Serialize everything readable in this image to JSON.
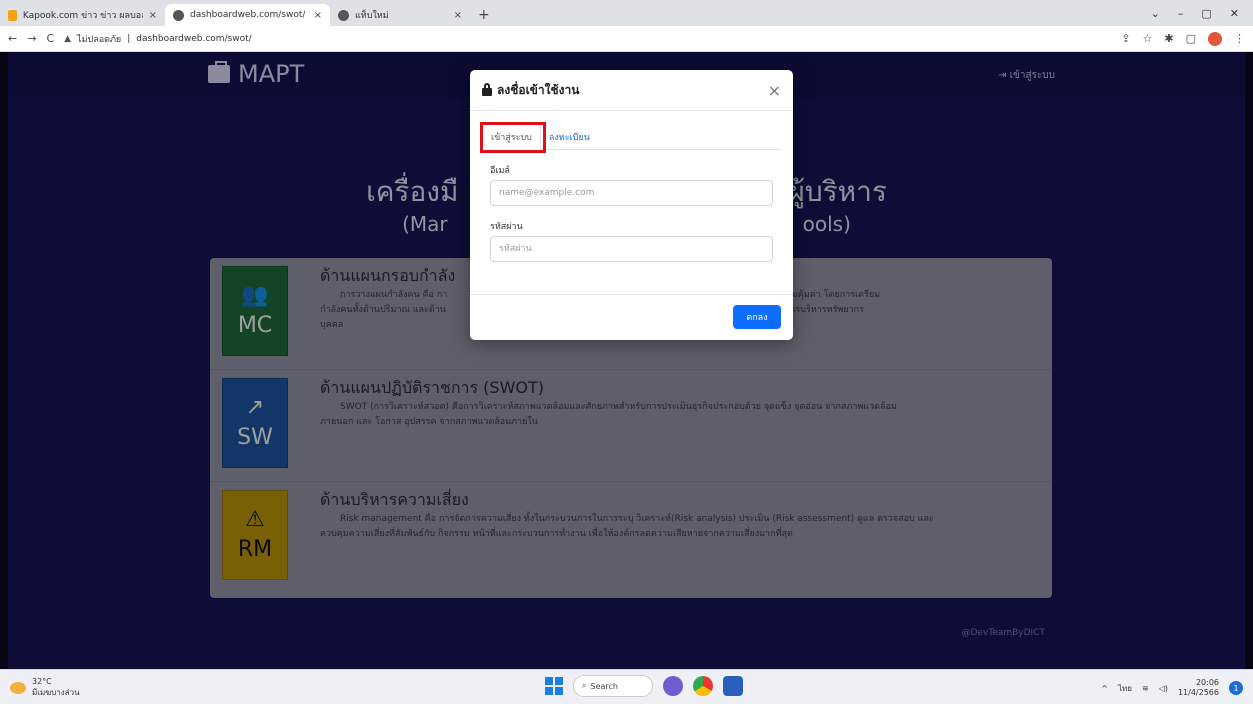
{
  "browser": {
    "tabs": [
      {
        "title": "Kapook.com ข่าว ข่าว ผลบอล ดูดวง",
        "close": "×"
      },
      {
        "title": "dashboardweb.com/swot/",
        "close": "×"
      },
      {
        "title": "แท็บใหม่",
        "close": "×"
      }
    ],
    "new_tab": "+",
    "security_label": "ไม่ปลอดภัย",
    "url": "dashboardweb.com/swot/",
    "window_controls": [
      "⌄",
      "–",
      "▢",
      "✕"
    ]
  },
  "navbar": {
    "brand": "MAPT",
    "login": "⇥ เข้าสู่ระบบ"
  },
  "hero": {
    "title_left": "เครื่องมื",
    "title_right": "ผู้บริหาร",
    "sub_left": "(Mar",
    "sub_right": "ools)"
  },
  "sections": [
    {
      "tile_label": "MC",
      "tile_icon": "users-icon",
      "title": "ด้านแผนกรอบกำลัง",
      "body_left": "การวางแผนกำลังคน คือ กา",
      "body_right": "เกิดประสิทธิภาพ และมีความคุ้มค่า โดยการเตรียม",
      "body_line2_left": "กำลังคนทั้งด้านปริมาณ และด้าน",
      "body_line2_right": "นี้เป็นเครื่องมือช่วยตัดสินใจ ในการบริหารทรัพยากร",
      "body_line3": "บุคคล"
    },
    {
      "tile_label": "SW",
      "tile_icon": "chart-line-icon",
      "title": "ด้านแผนปฏิบัติราชการ (SWOT)",
      "body": "SWOT (การวิเคราะห์สวอต) คือการวิเคราะห์สภาพแวดล้อมและศักยภาพสำหรับการประเมินธุรกิจประกอบด้วย จุดแข็ง จุดอ่อน จากสภาพแวดล้อม",
      "body_line2": "ภายนอก และ โอกาส อุปสรรค จากสภาพแวดล้อมภายใน"
    },
    {
      "tile_label": "RM",
      "tile_icon": "warning-icon",
      "title": "ด้านบริหารความเสี่ยง",
      "body": "Risk management คือ การจัดการความเสี่ยง ทั้งในกระบวนการในการระบุ วิเคราะห์(Risk analysis) ประเมิน (Risk assessment) ดูแล ตรวจสอบ และ",
      "body_line2": "ควบคุมความเสี่ยงที่สัมพันธ์กับ กิจกรรม หน้าที่และกระบวนการทำงาน เพื่อให้องค์กรลดความเสียหายจากความเสี่ยงมากที่สุด"
    }
  ],
  "footer": {
    "credit": "@DevTeamByDICT"
  },
  "modal": {
    "title": "ลงชื่อเข้าใช้งาน",
    "close": "×",
    "tab_login": "เข้าสู่ระบบ",
    "tab_register": "ลงทะเบียน",
    "email_label": "อีเมล์",
    "email_placeholder": "name@example.com",
    "password_label": "รหัสผ่าน",
    "password_placeholder": "รหัสผ่าน",
    "ok": "ตกลง",
    "highlight_color": "#e0101a",
    "accent_color": "#0d6efd"
  },
  "taskbar": {
    "temp": "32°C",
    "weather_desc": "มีเมฆบางส่วน",
    "search": "Search",
    "lang": "ไทย",
    "time": "20:06",
    "date": "11/4/2566",
    "notifications": "1"
  }
}
